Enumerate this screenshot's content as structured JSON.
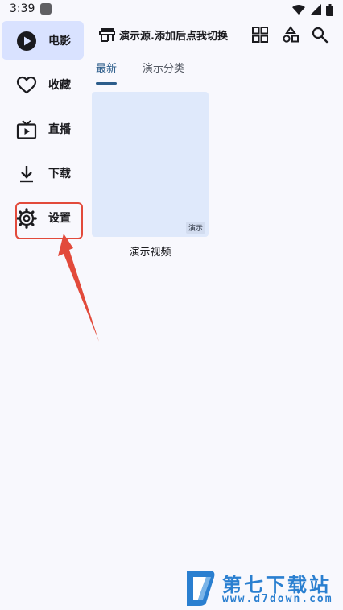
{
  "status_bar": {
    "time": "3:39",
    "icons": [
      "notification-icon",
      "wifi-icon",
      "signal-icon",
      "battery-icon"
    ]
  },
  "sidebar": {
    "items": [
      {
        "label": "电影",
        "icon": "play-circle-icon",
        "active": true
      },
      {
        "label": "收藏",
        "icon": "heart-icon",
        "active": false
      },
      {
        "label": "直播",
        "icon": "tv-icon",
        "active": false
      },
      {
        "label": "下载",
        "icon": "download-icon",
        "active": false
      },
      {
        "label": "设置",
        "icon": "gear-icon",
        "active": false
      }
    ]
  },
  "header": {
    "source_title": "演示源.添加后点我切换",
    "icons": [
      "source-store-icon",
      "grid-icon",
      "category-shapes-icon",
      "search-icon"
    ]
  },
  "tabs": [
    {
      "label": "最新",
      "active": true
    },
    {
      "label": "演示分类",
      "active": false
    }
  ],
  "videos": [
    {
      "title": "演示视频",
      "badge": "演示"
    }
  ],
  "watermark": {
    "title": "第七下载站",
    "url": "www.d7down.com"
  },
  "colors": {
    "accent": "#2c5d8b",
    "active_nav_bg": "#d9e2ff",
    "highlight": "#e24a3b",
    "card_bg": "#dfe9fb",
    "watermark": "#2a7fd0"
  }
}
